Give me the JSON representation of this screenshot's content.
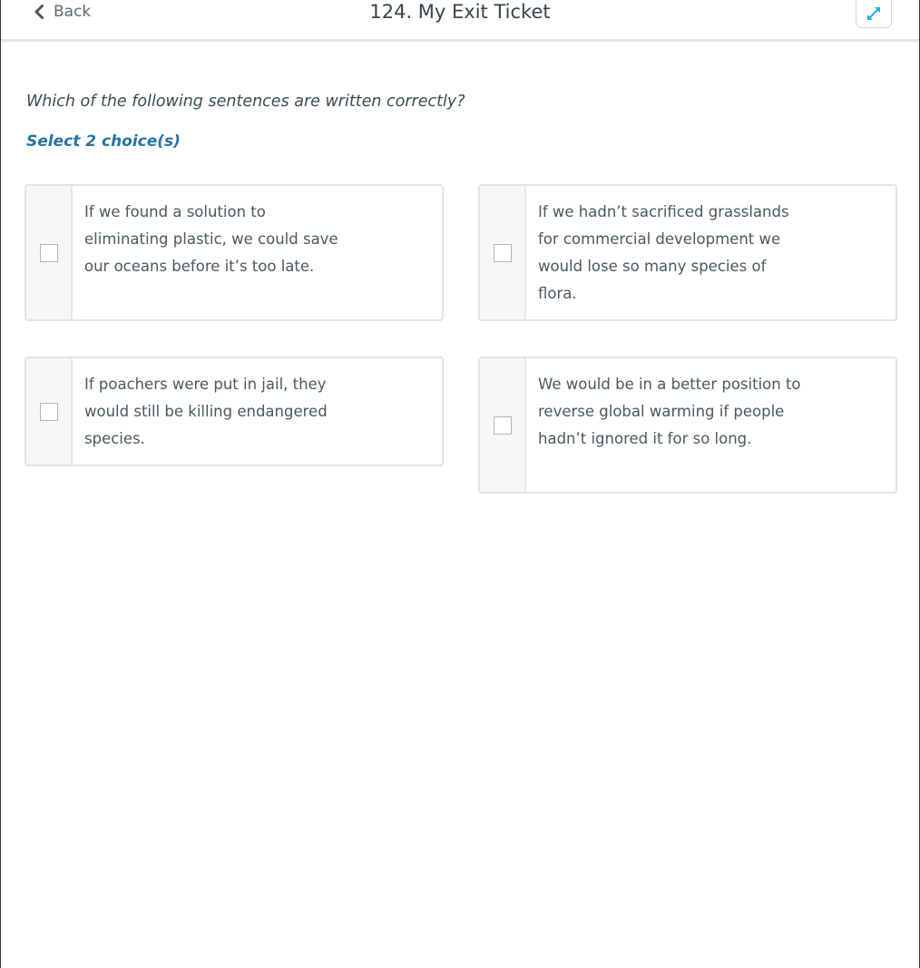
{
  "header": {
    "back_label": "Back",
    "title": "124. My Exit Ticket",
    "back_icon": "chevron-left-icon",
    "expand_icon": "expand-arrows-icon",
    "accent_color": "#29a8df"
  },
  "question": {
    "prompt": "Which of the following sentences are written correctly?",
    "instruction": "Select 2 choice(s)",
    "instruction_color": "#2673a3"
  },
  "choices": [
    {
      "text": "If we found a solution to eliminating plastic, we could save our oceans before it’s too late.",
      "checked": false
    },
    {
      "text": "If we hadn’t sacrificed grasslands for commercial development we would lose so many species of flora.",
      "checked": false
    },
    {
      "text": "If poachers were put in jail, they would still be killing endangered species.",
      "checked": false
    },
    {
      "text": "We would be in a better position to reverse global warming if people hadn’t ignored it for so long.",
      "checked": false
    }
  ]
}
